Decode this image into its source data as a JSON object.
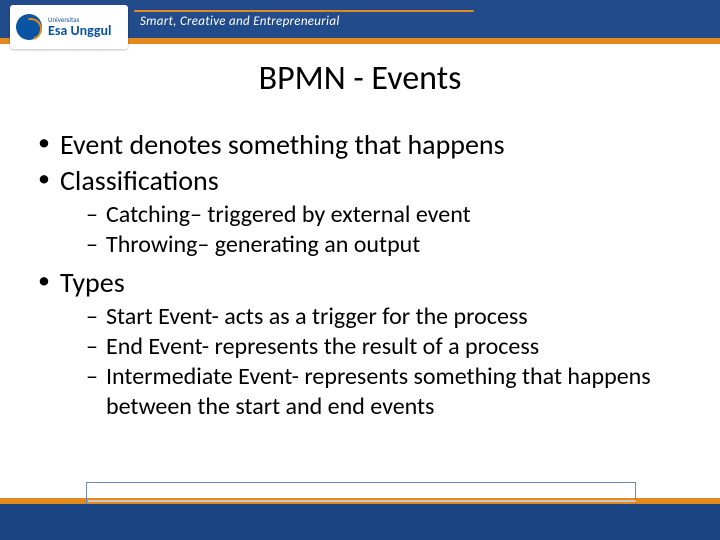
{
  "header": {
    "logo_sub": "Universitas",
    "logo_main": "Esa Unggul",
    "tagline": "Smart, Creative and Entrepreneurial"
  },
  "title": "BPMN - Events",
  "bullets": [
    {
      "text": "Event denotes something that happens",
      "children": []
    },
    {
      "text": "Classifications",
      "children": [
        "Catching– triggered by external event",
        "Throwing– generating an output"
      ]
    },
    {
      "text": "Types",
      "children": [
        "Start Event- acts as a trigger for the process",
        "End Event- represents the result of a process",
        "Intermediate Event- represents something that happens between the start and end events"
      ]
    }
  ]
}
